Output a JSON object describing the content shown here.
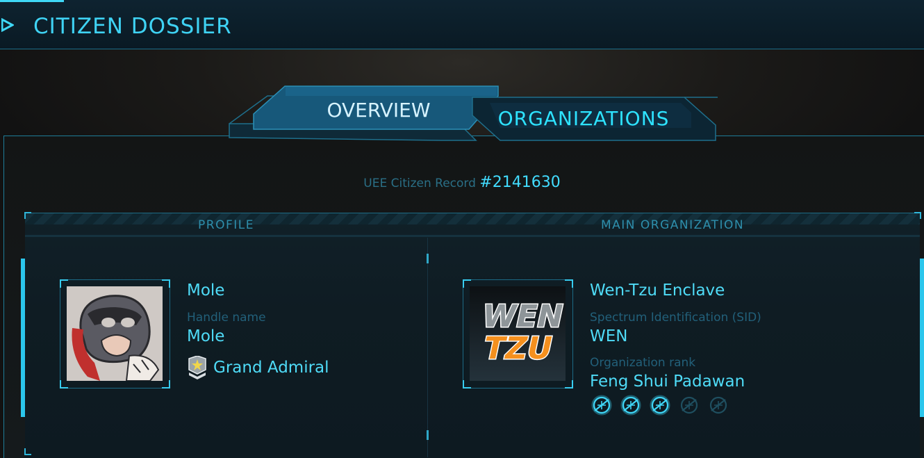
{
  "header": {
    "title": "CITIZEN DOSSIER"
  },
  "tabs": [
    {
      "label": "OVERVIEW",
      "active": true
    },
    {
      "label": "ORGANIZATIONS",
      "active": false
    }
  ],
  "record": {
    "prefix": "UEE Citizen Record ",
    "number": "#2141630"
  },
  "profile": {
    "section_label": "PROFILE",
    "display_name": "Mole",
    "handle_label": "Handle name",
    "handle": "Mole",
    "title": "Grand Admiral",
    "title_icon": "rank-badge-icon"
  },
  "organization": {
    "section_label": "MAIN ORGANIZATION",
    "name": "Wen-Tzu Enclave",
    "sid_label": "Spectrum Identification (SID)",
    "sid": "WEN",
    "rank_label": "Organization rank",
    "rank": "Feng Shui Padawan",
    "logo_text_1": "WEN",
    "logo_text_2": "TZU",
    "rank_stars": {
      "filled": 3,
      "total": 5
    }
  },
  "colors": {
    "accent": "#39e0ff",
    "label": "#22607a",
    "logo_orange": "#f5901e"
  }
}
